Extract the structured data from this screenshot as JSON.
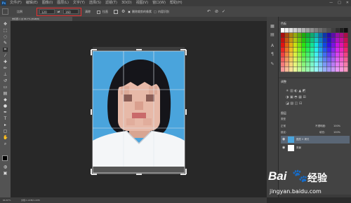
{
  "menubar": {
    "app_icon": "Ps",
    "items": [
      "文件(F)",
      "编辑(E)",
      "图像(I)",
      "图层(L)",
      "文字(Y)",
      "选择(S)",
      "滤镜(T)",
      "3D(D)",
      "视图(V)",
      "窗口(W)",
      "帮助(H)"
    ],
    "window_controls": [
      "—",
      "□",
      "✕"
    ]
  },
  "options": {
    "ratio_label": "比例",
    "width_value": "120",
    "swap_icon": "⇄",
    "height_value": "160",
    "clear_label": "清除",
    "straighten_label": "拉直",
    "grid_icon": "grid-icon",
    "gear_icon": "gear-icon",
    "delete_pixels_label": "删除裁剪的像素",
    "content_aware_label": "内容识别",
    "undo_icon": "↶",
    "cancel_icon": "⊘",
    "commit_icon": "✓"
  },
  "document": {
    "tab_label": "未标题-1 @ 66.7% (RGB/8)"
  },
  "status": {
    "zoom": "66.67%",
    "doc_info": "文档:1.22M/1.22M"
  },
  "panels": {
    "swatches_title": "色板",
    "adjustments_title": "调整",
    "layers_title": "图层",
    "layer_kind": "类型",
    "blend_mode": "正常",
    "opacity_label": "不透明度:",
    "opacity_value": "100%",
    "lock_label": "锁定:",
    "fill_label": "填充:",
    "fill_value": "100%",
    "layer_names": [
      "图层 0 拷贝",
      "背景"
    ]
  },
  "watermark": {
    "brand": "Bai",
    "brand_cn": "经验",
    "url": "jingyan.baidu.com"
  },
  "colors": {
    "annotation": "#e83030",
    "photo_bg": "#4aa4dc"
  }
}
